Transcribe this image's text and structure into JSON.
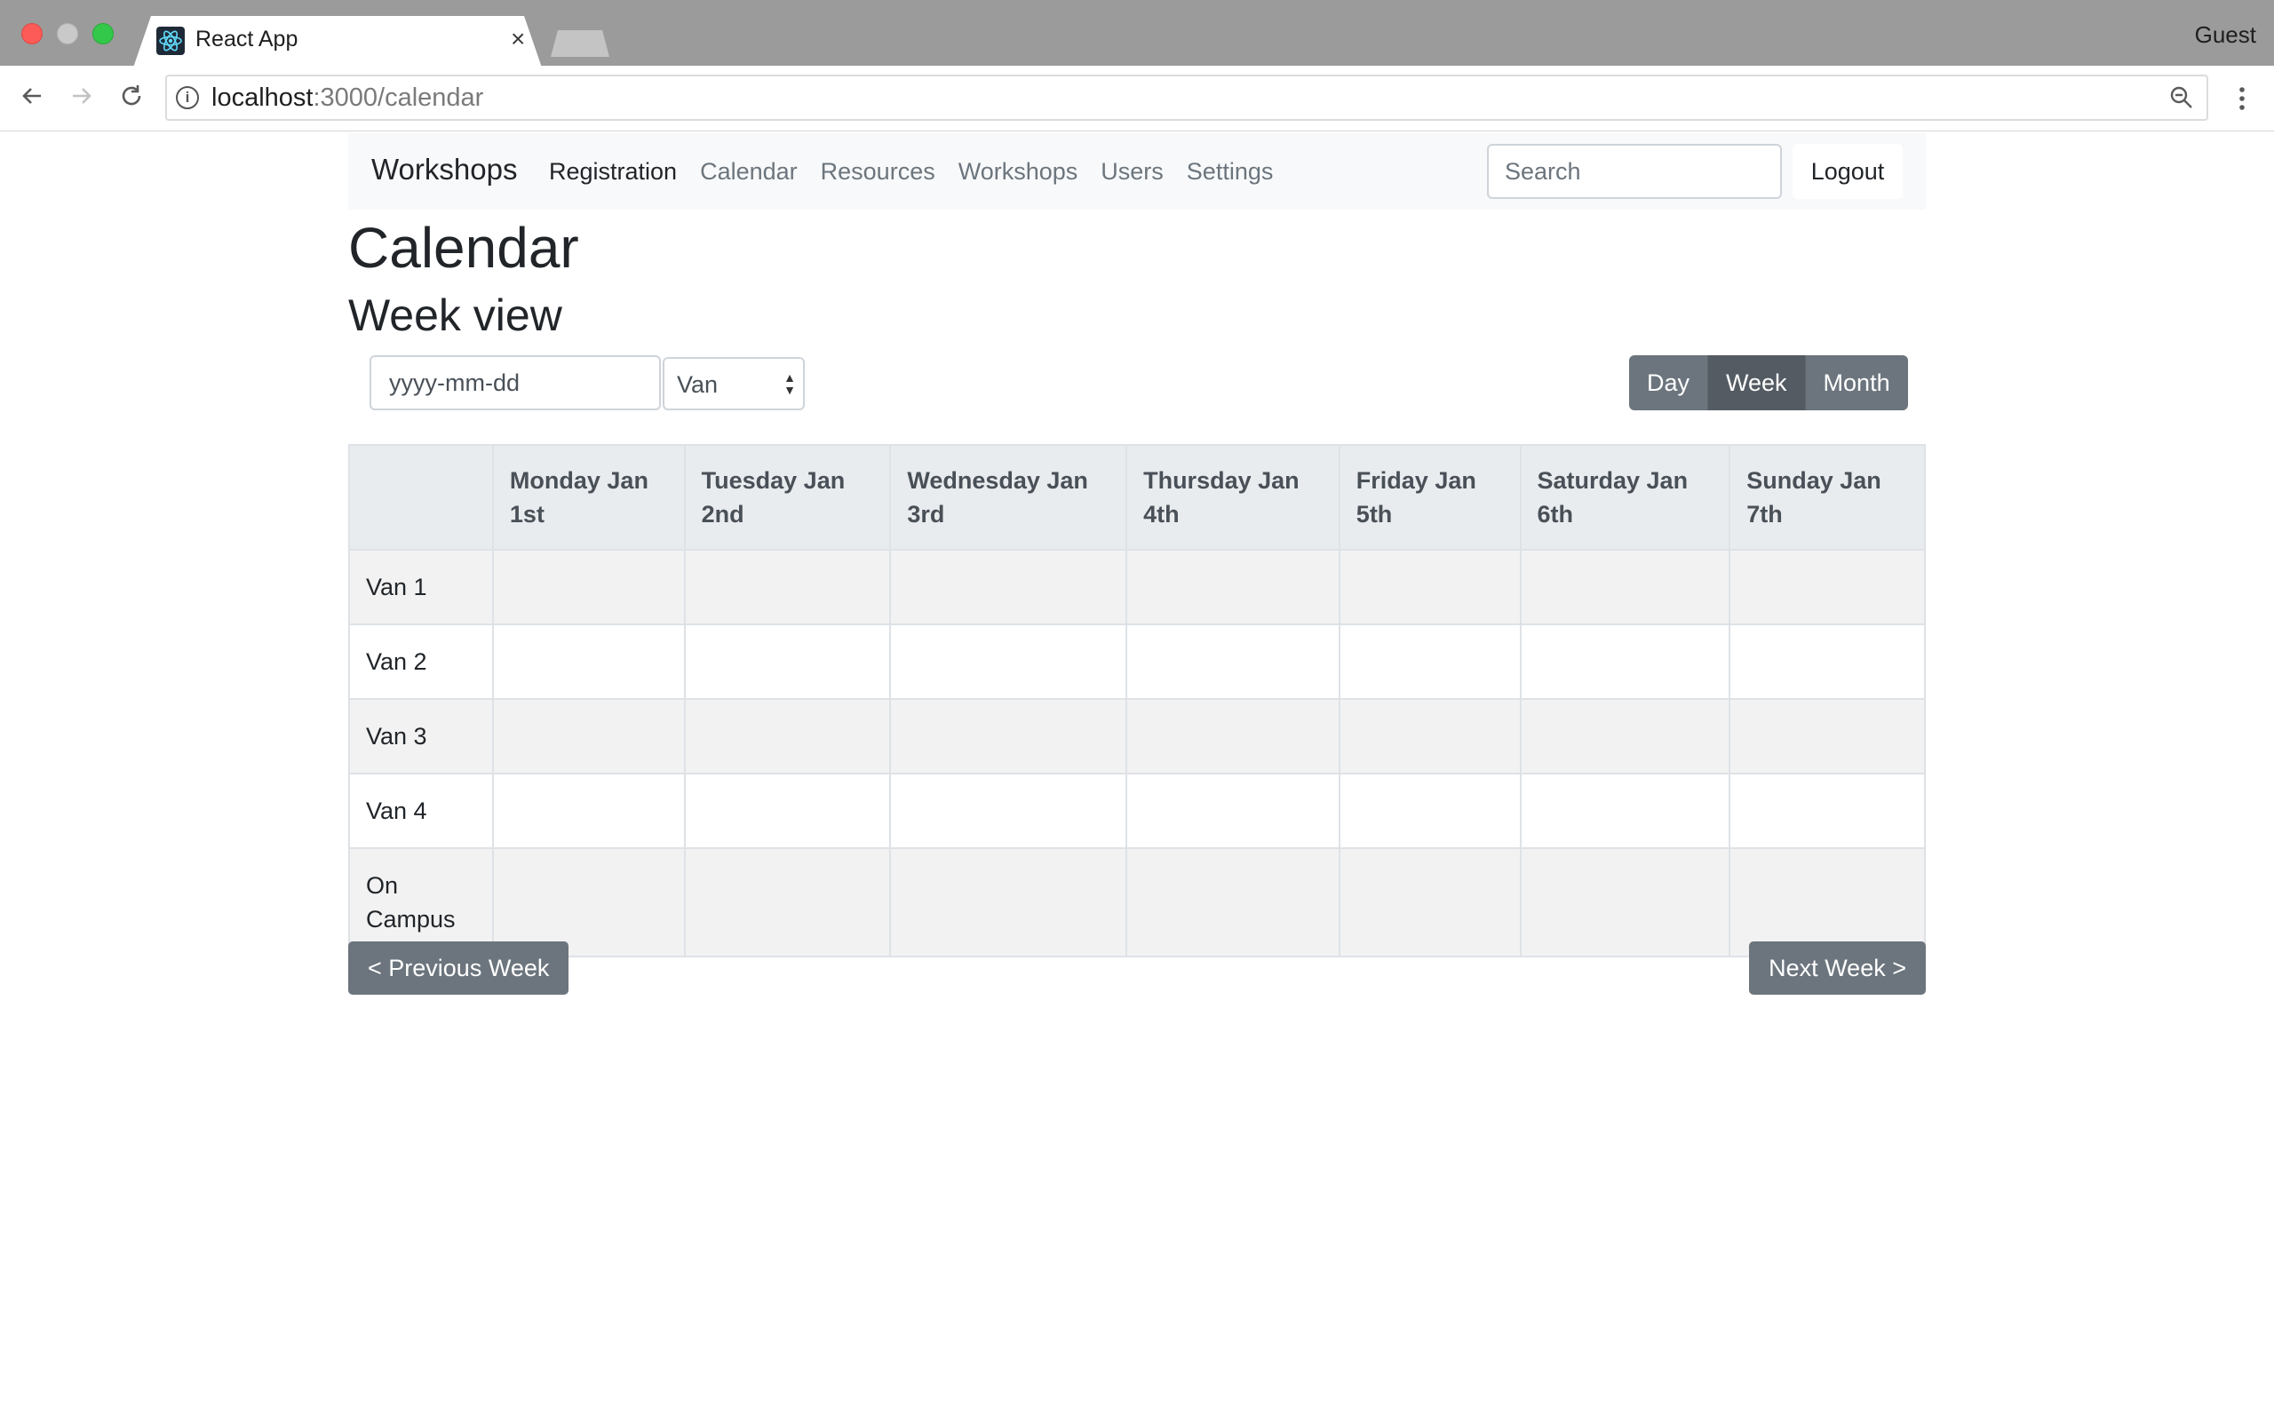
{
  "browser": {
    "tab_title": "React App",
    "tab_close": "×",
    "profile": "Guest",
    "url_host": "localhost",
    "url_path": ":3000/calendar"
  },
  "navbar": {
    "brand": "Workshops",
    "links": [
      "Registration",
      "Calendar",
      "Resources",
      "Workshops",
      "Users",
      "Settings"
    ],
    "active_link": "Registration",
    "search_placeholder": "Search",
    "logout_label": "Logout"
  },
  "page": {
    "title": "Calendar",
    "subtitle": "Week view"
  },
  "controls": {
    "date_placeholder": "yyyy-mm-dd",
    "resource_type": "Van",
    "view_buttons": [
      "Day",
      "Week",
      "Month"
    ],
    "active_view": "Week"
  },
  "calendar": {
    "columns": [
      "",
      "Monday Jan 1st",
      "Tuesday Jan 2nd",
      "Wednesday Jan 3rd",
      "Thursday Jan 4th",
      "Friday Jan 5th",
      "Saturday Jan 6th",
      "Sunday Jan 7th"
    ],
    "rows": [
      "Van 1",
      "Van 2",
      "Van 3",
      "Van 4",
      "On Campus"
    ]
  },
  "pager": {
    "previous_label": "< Previous Week",
    "next_label": "Next Week >"
  },
  "colors": {
    "secondary": "#6c757d",
    "secondary_active": "#545b62",
    "navbar_bg": "#f8f9fa",
    "table_header_bg": "#e9ecef"
  }
}
